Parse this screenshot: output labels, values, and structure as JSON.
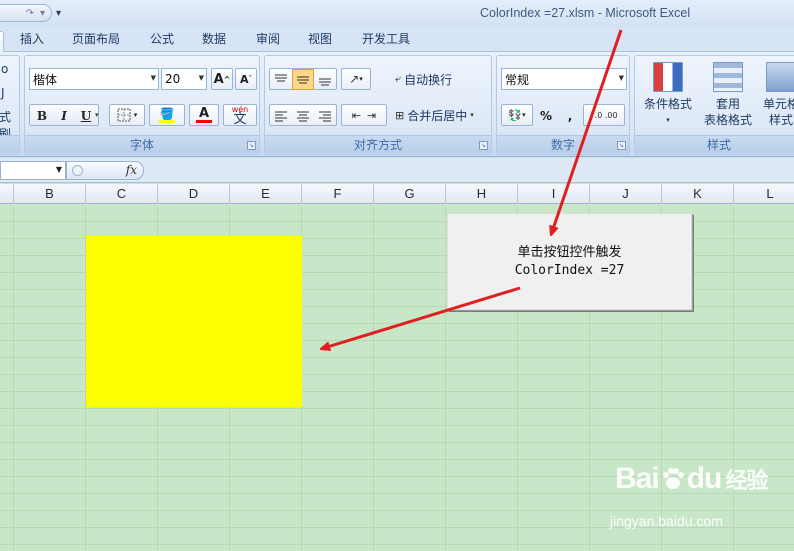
{
  "window": {
    "title": "ColorIndex =27.xlsm  -  Microsoft Excel"
  },
  "tabs": [
    "插入",
    "页面布局",
    "公式",
    "数据",
    "审阅",
    "视图",
    "开发工具"
  ],
  "ribbon": {
    "font": {
      "group_label": "字体",
      "font_name": "楷体",
      "font_size": "20",
      "grow_label": "A",
      "shrink_label": "A",
      "bold": "B",
      "italic": "I",
      "underline": "U",
      "font_color_label": "A",
      "phonetic_label": "wén",
      "phonetic_char": "文",
      "highlight_color": "#ffff00",
      "font_color": "#ff0000"
    },
    "alignment": {
      "group_label": "对齐方式",
      "wrap_text": "自动换行",
      "merge_center": "合并后居中"
    },
    "number": {
      "group_label": "数字",
      "format": "常规",
      "percent": "%",
      "comma": ","
    },
    "styles": {
      "group_label": "样式",
      "conditional": "条件格式",
      "table_line1": "套用",
      "table_line2": "表格格式",
      "cell_line1": "单元格",
      "cell_line2": "样式"
    },
    "left_partial": {
      "line1": "o",
      "line2": "J",
      "line3": "式刷"
    }
  },
  "formula_bar": {
    "fx_label": "fx",
    "name_box": ""
  },
  "columns": [
    "B",
    "C",
    "D",
    "E",
    "F",
    "G",
    "H",
    "I",
    "J",
    "K",
    "L"
  ],
  "sheet": {
    "yellow_fill": "#ffff00",
    "button_line1": "单击按钮控件触发",
    "button_line2": "ColorIndex =27"
  },
  "watermark": {
    "logo": "Bai",
    "logo_tail": "du",
    "logo_cn": "经验",
    "url": "jingyan.baidu.com"
  }
}
